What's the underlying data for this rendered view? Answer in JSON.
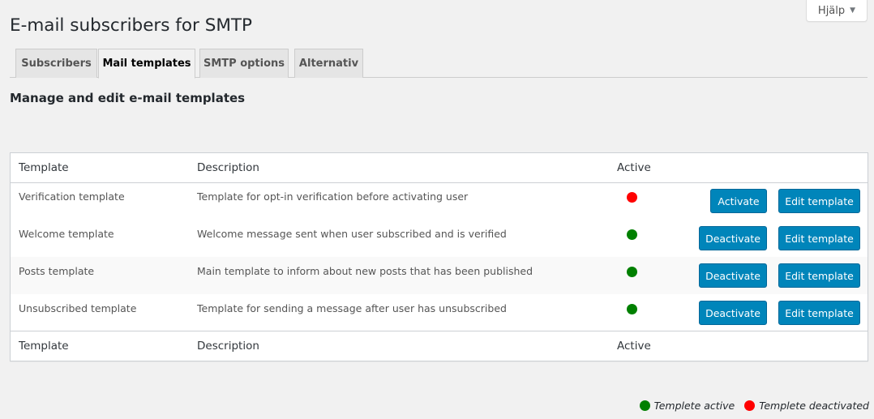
{
  "help": {
    "label": "Hjälp",
    "caret": "▼"
  },
  "page": {
    "title": "E-mail subscribers for SMTP",
    "subtitle": "Manage and edit e-mail templates"
  },
  "tabs": [
    {
      "label": "Subscribers",
      "active": false
    },
    {
      "label": "Mail templates",
      "active": true
    },
    {
      "label": "SMTP options",
      "active": false
    },
    {
      "label": "Alternativ",
      "active": false
    }
  ],
  "table": {
    "headers": {
      "template": "Template",
      "description": "Description",
      "active": "Active"
    },
    "rows": [
      {
        "template": "Verification template",
        "description": "Template for opt-in verification before activating user",
        "active": false,
        "toggle_label": "Activate",
        "edit_label": "Edit template"
      },
      {
        "template": "Welcome template",
        "description": "Welcome message sent when user subscribed and is verified",
        "active": true,
        "toggle_label": "Deactivate",
        "edit_label": "Edit template"
      },
      {
        "template": "Posts template",
        "description": "Main template to inform about new posts that has been published",
        "active": true,
        "toggle_label": "Deactivate",
        "edit_label": "Edit template"
      },
      {
        "template": "Unsubscribed template",
        "description": "Template for sending a message after user has unsubscribed",
        "active": true,
        "toggle_label": "Deactivate",
        "edit_label": "Edit template"
      }
    ]
  },
  "legend": {
    "active_label": "Templete active",
    "inactive_label": "Templete deactivated"
  },
  "colors": {
    "active": "#008000",
    "inactive": "#ff0000",
    "button": "#0085ba"
  }
}
